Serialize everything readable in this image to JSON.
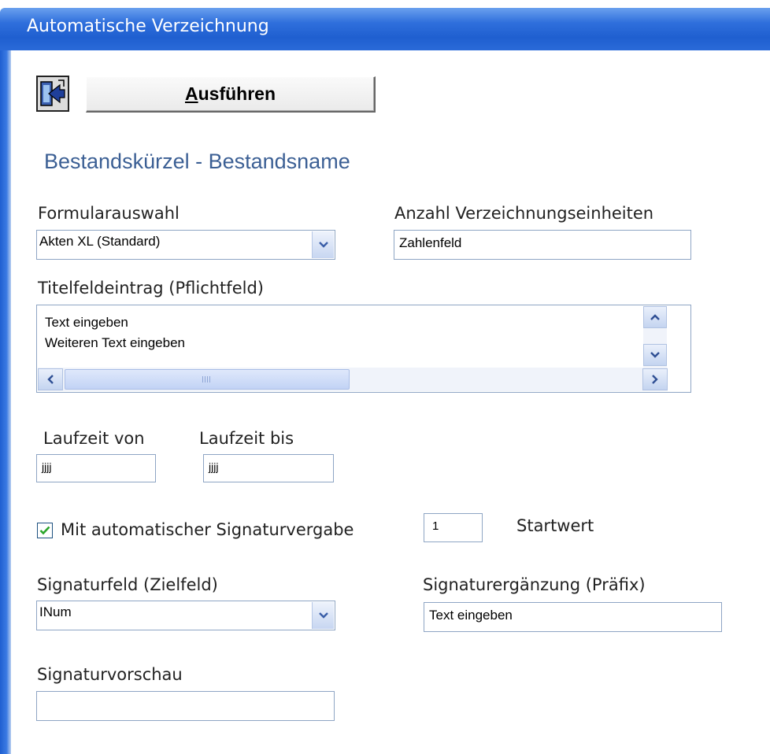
{
  "window": {
    "title": "Automatische Verzeichnung"
  },
  "toolbar": {
    "run_label_accel": "A",
    "run_label_rest": "usführen",
    "run_icon": "run-dialog-icon"
  },
  "section": {
    "title": "Bestandskürzel - Bestandsname"
  },
  "form_select": {
    "label": "Formularauswahl",
    "value": "Akten XL (Standard)"
  },
  "unit_count": {
    "label": "Anzahl Verzeichnungseinheiten",
    "value": "Zahlenfeld"
  },
  "title_field": {
    "label": "Titelfeldeintrag (Pflichtfeld)",
    "lines": [
      "Text eingeben",
      "Weiteren Text eingeben"
    ]
  },
  "runtime_from": {
    "label": "Laufzeit von",
    "value": "jjjj"
  },
  "runtime_to": {
    "label": "Laufzeit bis",
    "value": "jjjj"
  },
  "auto_signature": {
    "label": "Mit automatischer Signaturvergabe",
    "checked": true
  },
  "start_value": {
    "value": "1",
    "label": "Startwert"
  },
  "signature_field": {
    "label": "Signaturfeld (Zielfeld)",
    "value": "INum"
  },
  "signature_prefix": {
    "label": "Signaturergänzung (Präfix)",
    "value": "Text eingeben"
  },
  "signature_preview": {
    "label": "Signaturvorschau",
    "value": ""
  },
  "colors": {
    "titlebar": "#2f6fdc",
    "section_title": "#3b5f94",
    "field_border": "#8ea5c4",
    "check": "#2aa52a"
  }
}
